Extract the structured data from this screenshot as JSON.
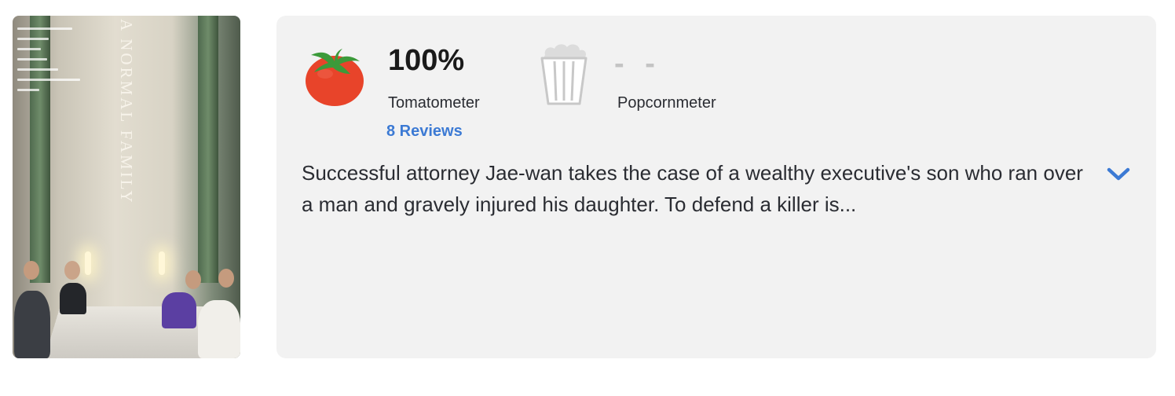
{
  "poster": {
    "title_text": "A NORMAL FAMILY"
  },
  "ratings": {
    "tomatometer": {
      "score": "100%",
      "label": "Tomatometer",
      "reviews_link": "8 Reviews",
      "icon": "fresh-tomato-icon",
      "color": "#e8442a"
    },
    "popcornmeter": {
      "score": "- -",
      "label": "Popcornmeter",
      "icon": "empty-popcorn-bucket-icon",
      "color": "#c4c4c4"
    }
  },
  "synopsis": {
    "text": "Successful attorney Jae-wan takes the case of a wealthy executive's son who ran over a man and gravely injured his daughter. To defend a killer is...",
    "expand_icon": "chevron-down-icon"
  },
  "colors": {
    "link": "#3c7ad4",
    "panel_bg": "#f2f2f2"
  }
}
